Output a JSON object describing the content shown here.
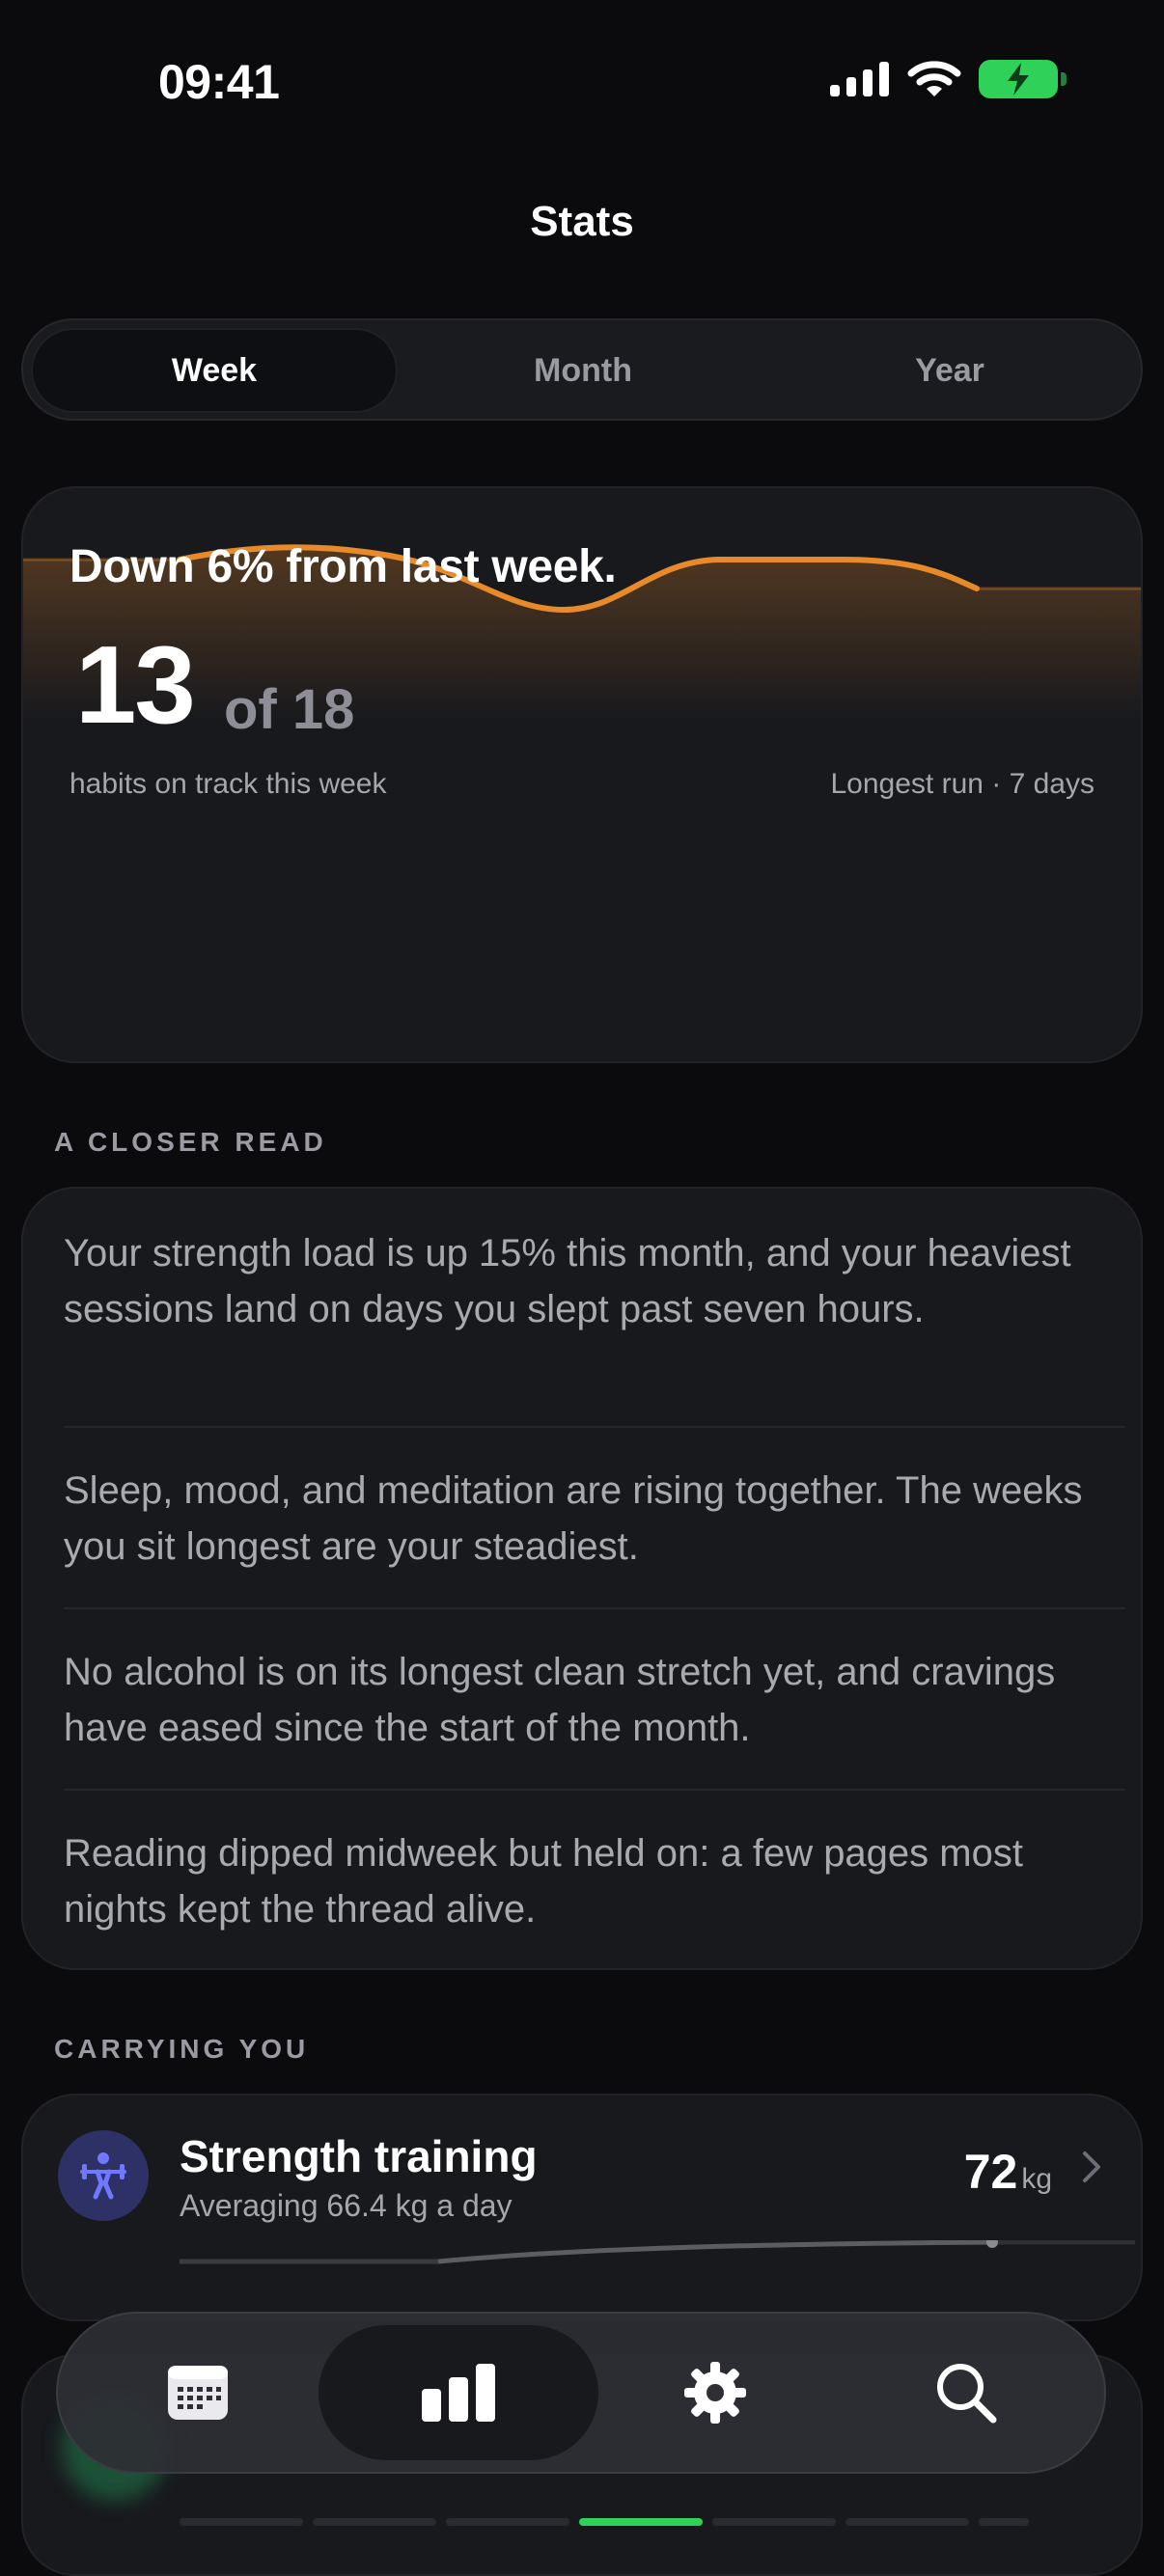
{
  "status_bar": {
    "time": "09:41"
  },
  "header": {
    "title": "Stats"
  },
  "segments": [
    {
      "label": "Week",
      "active": true
    },
    {
      "label": "Month",
      "active": false
    },
    {
      "label": "Year",
      "active": false
    }
  ],
  "summary": {
    "headline": "Down 6% from last week.",
    "count": "13",
    "of_total": "of 18",
    "caption": "habits on track this week",
    "longest_run": "Longest run · 7 days",
    "accent_color": "#e88a2a"
  },
  "closer_read": {
    "label": "A CLOSER READ",
    "insights": [
      "Your strength load is up 15% this month, and your heaviest sessions land on days you slept past seven hours.",
      "Sleep, mood, and meditation are rising together. The weeks you sit longest are your steadiest.",
      "No alcohol is on its longest clean stretch yet, and cravings have eased since the start of the month.",
      "Reading dipped midweek but held on: a few pages most nights kept the thread alive."
    ]
  },
  "carrying": {
    "label": "CARRYING YOU",
    "items": [
      {
        "title": "Strength training",
        "subtitle": "Averaging 66.4 kg a day",
        "value": "72",
        "unit": "kg",
        "icon": "weightlifter-icon",
        "icon_color": "#5b63e6"
      }
    ]
  },
  "tabbar": {
    "tabs": [
      {
        "icon": "calendar-icon",
        "active": false
      },
      {
        "icon": "bar-chart-icon",
        "active": true
      },
      {
        "icon": "gear-icon",
        "active": false
      },
      {
        "icon": "search-icon",
        "active": false
      }
    ]
  }
}
